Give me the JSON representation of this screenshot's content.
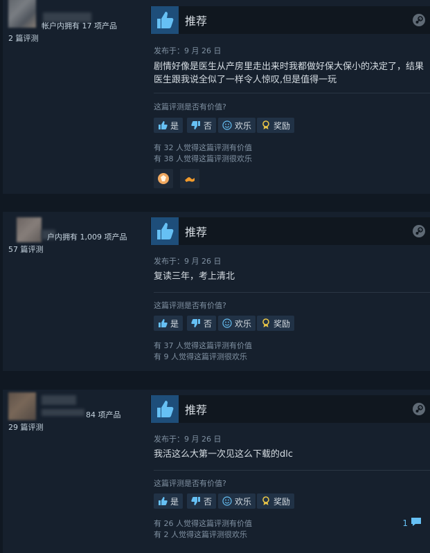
{
  "ui": {
    "recommend_label": "推荐",
    "helpful_question": "这篇评测是否有价值?",
    "btn_yes": "是",
    "btn_no": "否",
    "btn_funny": "欢乐",
    "btn_award": "奖励"
  },
  "reviews": [
    {
      "products_text": "帐户内拥有 17 项产品",
      "reviews_text": "2 篇评测",
      "date": "发布于：9 月 26 日",
      "content": "剧情好像是医生从产房里走出来时我都做好保大保小的决定了，结果医生跟我说全似了一样令人惊叹,但是值得一玩",
      "helpful": "有 32 人觉得这篇评测有价值",
      "funny": "有 38 人觉得这篇评测很欢乐",
      "awards": [
        "clap-award-icon",
        "flex-award-icon"
      ]
    },
    {
      "products_text": "户内拥有 1,009 项产品",
      "reviews_text": "57 篇评测",
      "date": "发布于：9 月 26 日",
      "content": "复读三年，考上清北",
      "helpful": "有 37 人觉得这篇评测有价值",
      "funny": "有 9 人觉得这篇评测很欢乐"
    },
    {
      "products_text": "84 项产品",
      "reviews_text": "29 篇评测",
      "date": "发布于：9 月 26 日",
      "content": "我活这么大第一次见这么下载的dlc",
      "helpful": "有 26 人觉得这篇评测有价值",
      "funny": "有 2 人觉得这篇评测很欢乐",
      "comment_count": "1"
    }
  ]
}
